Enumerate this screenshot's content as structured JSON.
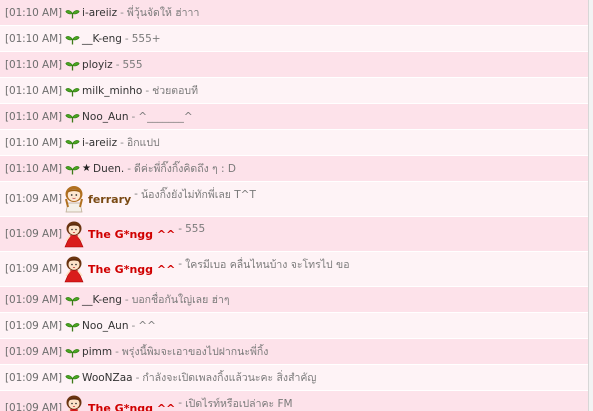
{
  "colors": {
    "row_pink": "#fde2ea",
    "row_light": "#fef3f6",
    "nick_red": "#d00000",
    "nick_brown": "#7a4a14",
    "sprout_green": "#3c9a1c"
  },
  "messages": [
    {
      "time": "[01:10 AM]",
      "icon": "sprout-icon",
      "nick": "i-areiiz",
      "sep": "-",
      "text": "พี่วุ้นจัดให้ ฮ่าาา"
    },
    {
      "time": "[01:10 AM]",
      "icon": "sprout-icon",
      "nick": "__K-eng",
      "sep": "-",
      "text": "555+"
    },
    {
      "time": "[01:10 AM]",
      "icon": "sprout-icon",
      "nick": "ployiz",
      "sep": "-",
      "text": "555"
    },
    {
      "time": "[01:10 AM]",
      "icon": "sprout-icon",
      "nick": "milk_minho",
      "sep": "-",
      "text": "ช่วยตอบที"
    },
    {
      "time": "[01:10 AM]",
      "icon": "sprout-icon",
      "nick": "Noo_Aun",
      "sep": "-",
      "text": "^_______^"
    },
    {
      "time": "[01:10 AM]",
      "icon": "sprout-icon",
      "nick": "i-areiiz",
      "sep": "-",
      "text": "อิกแปป"
    },
    {
      "time": "[01:10 AM]",
      "icon": "sprout-icon",
      "nick_prefix": "★",
      "nick": "Duen.",
      "sep": "-",
      "text": "ดีค่ะพี่กิ๊งกิ๊งคิดถึง ๆ : D"
    },
    {
      "time": "[01:09 AM]",
      "icon": "girl-avatar-icon",
      "nick": "ferrary",
      "sep": "-",
      "text": "น้องกิ๊งยังไม่ทักพี่เลย T^T"
    },
    {
      "time": "[01:09 AM]",
      "icon": "red-dress-avatar-icon",
      "nick": "The G*ngg ^^",
      "sep": "-",
      "text": "555"
    },
    {
      "time": "[01:09 AM]",
      "icon": "red-dress-avatar-icon",
      "nick": "The G*ngg ^^",
      "sep": "-",
      "text": "ใครมีเบอ คลื่นไหนบ้าง จะโทรไป ขอ"
    },
    {
      "time": "[01:09 AM]",
      "icon": "sprout-icon",
      "nick": "__K-eng",
      "sep": "-",
      "text": "บอกชื่อกันใญ่เลย ฮ่าๆ"
    },
    {
      "time": "[01:09 AM]",
      "icon": "sprout-icon",
      "nick": "Noo_Aun",
      "sep": "-",
      "text": "^^"
    },
    {
      "time": "[01:09 AM]",
      "icon": "sprout-icon",
      "nick": "pimm",
      "sep": "-",
      "text": "พรุ่งนี้พิมจะเอาของไปฝากนะพี่กิ้ง"
    },
    {
      "time": "[01:09 AM]",
      "icon": "sprout-icon",
      "nick": "WooNZaa",
      "sep": "-",
      "text": "กำลังจะเปิดเพลงกิ้งแล้วนะคะ สิ่งสำคัญ"
    },
    {
      "time": "[01:09 AM]",
      "icon": "red-dress-avatar-icon",
      "nick": "The G*ngg ^^",
      "sep": "-",
      "text": "เปิดไรท์หรือเปล่าคะ FM"
    }
  ]
}
